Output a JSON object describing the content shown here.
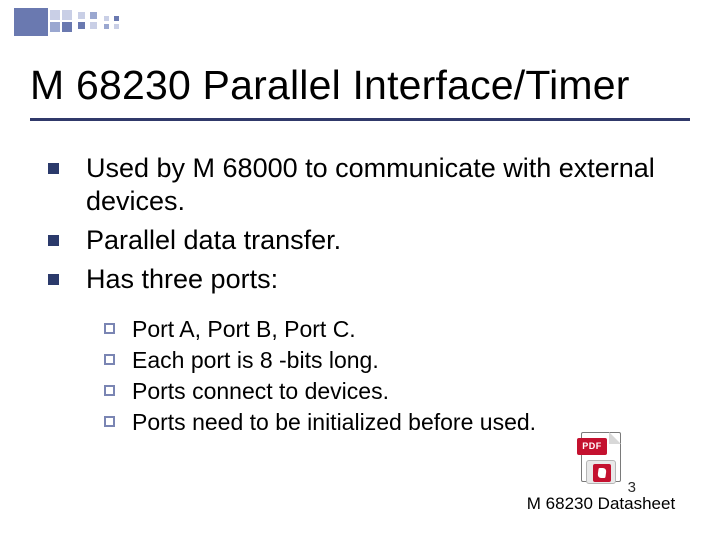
{
  "title": "M 68230 Parallel Interface/Timer",
  "bullets": [
    "Used by M 68000 to communicate with external devices.",
    "Parallel data transfer.",
    "Has three ports:"
  ],
  "sub_bullets": [
    "Port A, Port B, Port C.",
    "Each port is 8 -bits long.",
    "Ports connect to devices.",
    "Ports need to be initialized before used."
  ],
  "pdf": {
    "badge": "PDF",
    "caption": "M 68230 Datasheet"
  },
  "page_number": "3"
}
